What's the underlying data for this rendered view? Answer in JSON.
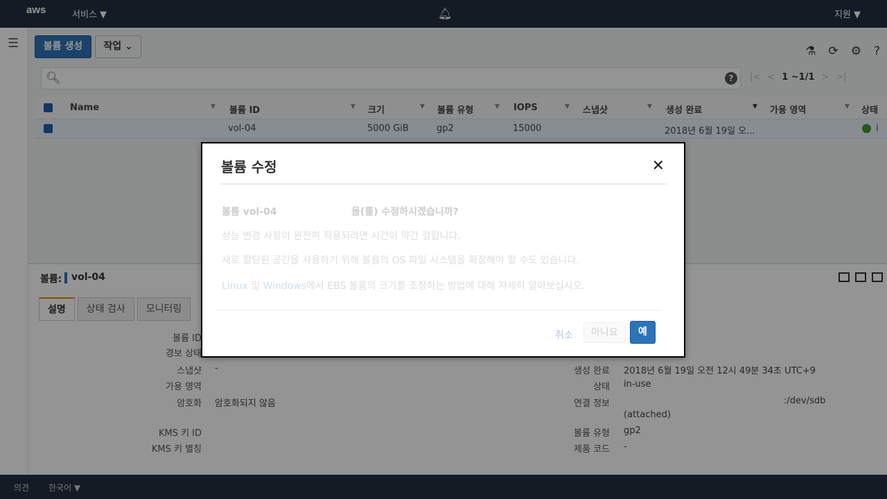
{
  "topnav": {
    "logo": "aws",
    "services": "서비스 ▼",
    "support": "지원 ▼"
  },
  "toolbar": {
    "create_label": "볼륨 생성",
    "actions_label": "작업 ⌄"
  },
  "pager": {
    "first": "|<",
    "prev": "<",
    "count": "1 ~1/1",
    "next": ">",
    "last": ">|"
  },
  "table": {
    "headers": [
      "Name",
      "볼륨 ID",
      "크기",
      "볼륨 유형",
      "IOPS",
      "스냅샷",
      "생성 완료",
      "가용 영역",
      "상태"
    ],
    "rows": [
      {
        "name": "",
        "volume_id": "vol-04",
        "size": "5000 GiB",
        "type": "gp2",
        "iops": "15000",
        "snapshot": "",
        "created": "2018년 6월 19일 오...",
        "az": "",
        "state": "i"
      }
    ]
  },
  "detail": {
    "label": "볼륨:",
    "name": "vol-04",
    "tabs": [
      "설명",
      "상태 검사",
      "모니터링"
    ],
    "left": [
      {
        "key": "볼륨 ID",
        "value": ""
      },
      {
        "key": "경보 상태",
        "value": ""
      },
      {
        "key": "스냅샷",
        "value": "-"
      },
      {
        "key": "가용 영역",
        "value": ""
      },
      {
        "key": "암호화",
        "value": "암호화되지 않음"
      },
      {
        "key": "KMS 키 ID",
        "value": ""
      },
      {
        "key": "KMS 키 별칭",
        "value": ""
      }
    ],
    "right": [
      {
        "key": "생성 완료",
        "value": "2018년 6월 19일 오전 12시 49분 34초 UTC+9"
      },
      {
        "key": "상태",
        "value": "in-use"
      },
      {
        "key": "연결 정보",
        "value": ":/dev/sdb",
        "value2": "(attached)"
      },
      {
        "key": "볼륨 유형",
        "value": "gp2"
      },
      {
        "key": "제품 코드",
        "value": "-"
      }
    ]
  },
  "modal": {
    "title": "볼륨 수정",
    "line1_prefix": "볼륨 vol-04",
    "line1_question": "을(를) 수정하시겠습니까?",
    "line2": "성능 변경 사항이 완전히 적용되려면 시간이 약간 걸립니다.",
    "line3": "새로 할당된 공간을 사용하기 위해 볼륨의 OS 파일 시스템을 확장해야 할 수도 있습니다.",
    "line4_link1": "Linux",
    "line4_and": " 및 ",
    "line4_link2": "Windows",
    "line4_rest": "에서 EBS 볼륨의 크기를 조정하는 방법에 대해 자세히 알아보십시오.",
    "cancel": "취소",
    "no": "아니요",
    "yes": "예"
  },
  "footer": {
    "feedback": "의견",
    "language": "한국어 ▼"
  },
  "colors": {
    "nav": "#232f3e",
    "primary": "#2e73b8",
    "accent_tab": "#e68a00",
    "running": "#3c9b2a"
  }
}
